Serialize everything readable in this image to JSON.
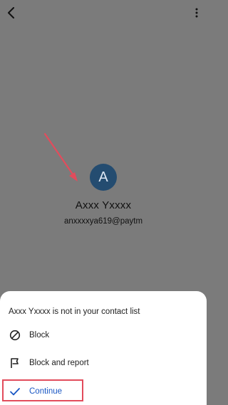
{
  "contact": {
    "initial": "A",
    "name": "Axxx Yxxxx",
    "upi_id": "anxxxxya619@paytm"
  },
  "sheet": {
    "title": "Axxx Yxxxx is not in your contact list",
    "options": [
      {
        "label": "Block",
        "icon": "block-icon"
      },
      {
        "label": "Block and report",
        "icon": "flag-icon"
      },
      {
        "label": "Continue",
        "icon": "check-icon"
      }
    ]
  },
  "colors": {
    "avatar_bg": "#244c70",
    "continue_text": "#1a57c4",
    "annotation": "#e24c5c",
    "scrim": "#7b7b7b"
  }
}
